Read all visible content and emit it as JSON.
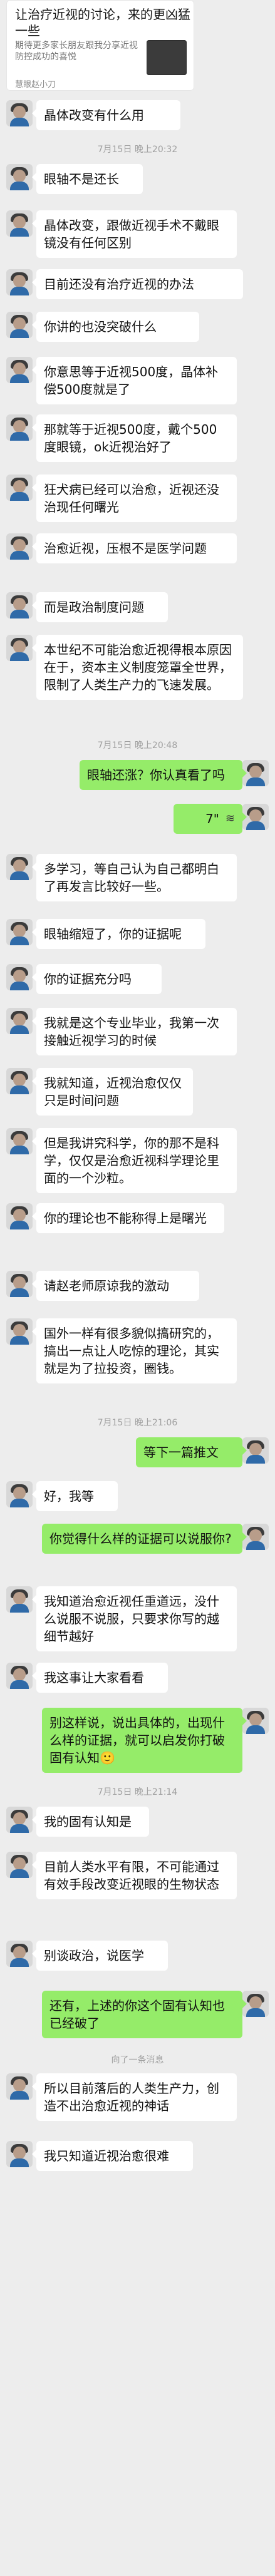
{
  "top_card": {
    "title": "让治疗近视的讨论，来的更凶猛一些",
    "subtitle": "期待更多家长朋友跟我分享近视防控成功的喜悦",
    "source": "慧眼赵小刀"
  },
  "timestamps": {
    "t1": "7月15日 晚上20:32",
    "t2": "7月15日 晚上20:48",
    "t3": "7月15日 晚上21:06",
    "t4": "7月15日 晚上21:14"
  },
  "messages": [
    {
      "side": "left",
      "text": "晶体改变有什么用"
    },
    {
      "side": "left",
      "text": "眼轴不是还长"
    },
    {
      "side": "left",
      "text": "晶体改变，跟做近视手术不戴眼镜没有任何区别"
    },
    {
      "side": "left",
      "text": "目前还没有治疗近视的办法"
    },
    {
      "side": "left",
      "text": "你讲的也没突破什么"
    },
    {
      "side": "left",
      "text": "你意思等于近视500度，晶体补偿500度就是了"
    },
    {
      "side": "left",
      "text": "那就等于近视500度，戴个500度眼镜，ok近视治好了"
    },
    {
      "side": "left",
      "text": "狂犬病已经可以治愈，近视还没治现任何曙光"
    },
    {
      "side": "left",
      "text": "治愈近视，压根不是医学问题"
    },
    {
      "side": "left",
      "text": "而是政治制度问题"
    },
    {
      "side": "left",
      "text": "本世纪不可能治愈近视得根本原因在于，资本主义制度笼罩全世界，限制了人类生产力的飞速发展。"
    },
    {
      "side": "right",
      "text": "眼轴还涨？你认真看了吗"
    },
    {
      "side": "right",
      "voice": "7\"",
      "text": ""
    },
    {
      "side": "left",
      "text": "多学习，等自己认为自己都明白了再发言比较好一些。"
    },
    {
      "side": "left",
      "text": "眼轴缩短了，你的证据呢"
    },
    {
      "side": "left",
      "text": "你的证据充分吗"
    },
    {
      "side": "left",
      "text": "我就是这个专业毕业，我第一次接触近视学习的时候"
    },
    {
      "side": "left",
      "text": "我就知道，近视治愈仅仅只是时间问题"
    },
    {
      "side": "left",
      "text": "但是我讲究科学，你的那不是科学，仅仅是治愈近视科学理论里面的一个沙粒。"
    },
    {
      "side": "left",
      "text": "你的理论也不能称得上是曙光"
    },
    {
      "side": "left",
      "text": "请赵老师原谅我的激动"
    },
    {
      "side": "left",
      "text": "国外一样有很多貌似搞研究的，搞出一点让人吃惊的理论，其实就是为了拉投资，圈钱。"
    },
    {
      "side": "right",
      "text": "等下一篇推文"
    },
    {
      "side": "left",
      "text": "好，我等"
    },
    {
      "side": "right",
      "text": "你觉得什么样的证据可以说服你?"
    },
    {
      "side": "left",
      "text": "我知道治愈近视任重道远，没什么说服不说服，只要求你写的越细节越好"
    },
    {
      "side": "left",
      "text": "我这事让大家看看"
    },
    {
      "side": "right",
      "text": "别这样说，说出具体的，出现什么样的证据，就可以启发你打破固有认知🙂"
    },
    {
      "side": "left",
      "text": "我的固有认知是"
    },
    {
      "side": "left",
      "text": "目前人类水平有限，不可能通过有效手段改变近视眼的生物状态"
    },
    {
      "side": "left",
      "text": "别谈政治，说医学"
    },
    {
      "side": "right",
      "text": "还有，上述的你这个固有认知也已经破了"
    },
    {
      "side": "left",
      "text": "所以目前落后的人类生产力，创造不出治愈近视的神话"
    },
    {
      "side": "left",
      "text": "我只知道近视治愈很难"
    }
  ],
  "system_notice": "向了一条消息"
}
